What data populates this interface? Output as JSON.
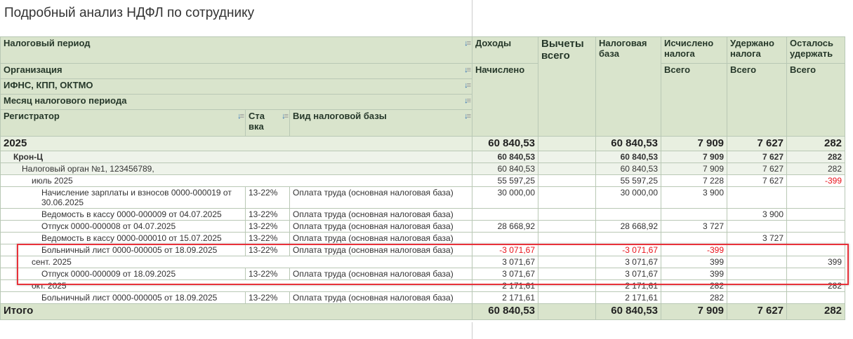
{
  "title": "Подробный анализ НДФЛ по сотруднику",
  "header": {
    "period": "Налоговый период",
    "org": "Организация",
    "ifns": "ИФНС, КПП, ОКТМО",
    "month": "Месяц налогового периода",
    "registrar": "Регистратор",
    "rate": "Ста вка",
    "base_kind": "Вид налоговой базы",
    "income": "Доходы",
    "income_sub": "Начислено",
    "deductions": "Вычеты всего",
    "tax_base": "Налоговая база",
    "calculated": "Исчислено налога",
    "withheld": "Удержано налога",
    "remaining": "Осталось удержать",
    "total_sub": "Всего"
  },
  "rows": [
    {
      "level": 0,
      "label": "2025",
      "rate": "",
      "kind": "",
      "income": "60 840,53",
      "ded": "",
      "base": "60 840,53",
      "calc": "7 909",
      "held": "7 627",
      "rem": "282"
    },
    {
      "level": 1,
      "label": "Крон-Ц",
      "rate": "",
      "kind": "",
      "income": "60 840,53",
      "ded": "",
      "base": "60 840,53",
      "calc": "7 909",
      "held": "7 627",
      "rem": "282"
    },
    {
      "level": 2,
      "label": "Налоговый орган №1, 123456789,",
      "rate": "",
      "kind": "",
      "income": "60 840,53",
      "ded": "",
      "base": "60 840,53",
      "calc": "7 909",
      "held": "7 627",
      "rem": "282"
    },
    {
      "level": 3,
      "label": "июль 2025",
      "rate": "",
      "kind": "",
      "income": "55 597,25",
      "ded": "",
      "base": "55 597,25",
      "calc": "7 228",
      "held": "7 627",
      "rem": "-399"
    },
    {
      "level": 4,
      "label": "Начисление зарплаты и взносов 0000-000019 от 30.06.2025",
      "rate": "13-22%",
      "kind": "Оплата труда (основная налоговая база)",
      "income": "30 000,00",
      "ded": "",
      "base": "30 000,00",
      "calc": "3 900",
      "held": "",
      "rem": ""
    },
    {
      "level": 4,
      "label": "Ведомость в кассу 0000-000009 от 04.07.2025",
      "rate": "13-22%",
      "kind": "Оплата труда (основная налоговая база)",
      "income": "",
      "ded": "",
      "base": "",
      "calc": "",
      "held": "3 900",
      "rem": ""
    },
    {
      "level": 4,
      "label": "Отпуск 0000-000008 от 04.07.2025",
      "rate": "13-22%",
      "kind": "Оплата труда (основная налоговая база)",
      "income": "28 668,92",
      "ded": "",
      "base": "28 668,92",
      "calc": "3 727",
      "held": "",
      "rem": ""
    },
    {
      "level": 4,
      "label": "Ведомость в кассу 0000-000010 от 15.07.2025",
      "rate": "13-22%",
      "kind": "Оплата труда (основная налоговая база)",
      "income": "",
      "ded": "",
      "base": "",
      "calc": "",
      "held": "3 727",
      "rem": ""
    },
    {
      "level": 4,
      "label": "Больничный лист 0000-000005 от 18.09.2025",
      "rate": "13-22%",
      "kind": "Оплата труда (основная налоговая база)",
      "income": "-3 071,67",
      "ded": "",
      "base": "-3 071,67",
      "calc": "-399",
      "held": "",
      "rem": ""
    },
    {
      "level": 3,
      "label": "сент. 2025",
      "rate": "",
      "kind": "",
      "income": "3 071,67",
      "ded": "",
      "base": "3 071,67",
      "calc": "399",
      "held": "",
      "rem": "399"
    },
    {
      "level": 4,
      "label": "Отпуск 0000-000009 от 18.09.2025",
      "rate": "13-22%",
      "kind": "Оплата труда (основная налоговая база)",
      "income": "3 071,67",
      "ded": "",
      "base": "3 071,67",
      "calc": "399",
      "held": "",
      "rem": ""
    },
    {
      "level": 3,
      "label": "окт. 2025",
      "rate": "",
      "kind": "",
      "income": "2 171,61",
      "ded": "",
      "base": "2 171,61",
      "calc": "282",
      "held": "",
      "rem": "282"
    },
    {
      "level": 4,
      "label": "Больничный лист 0000-000005 от 18.09.2025",
      "rate": "13-22%",
      "kind": "Оплата труда (основная налоговая база)",
      "income": "2 171,61",
      "ded": "",
      "base": "2 171,61",
      "calc": "282",
      "held": "",
      "rem": ""
    }
  ],
  "total": {
    "label": "Итого",
    "income": "60 840,53",
    "ded": "",
    "base": "60 840,53",
    "calc": "7 909",
    "held": "7 627",
    "rem": "282"
  },
  "colors": {
    "header_bg": "#d9e4cc",
    "negative": "#e8121a",
    "highlight": "#e8323a"
  }
}
